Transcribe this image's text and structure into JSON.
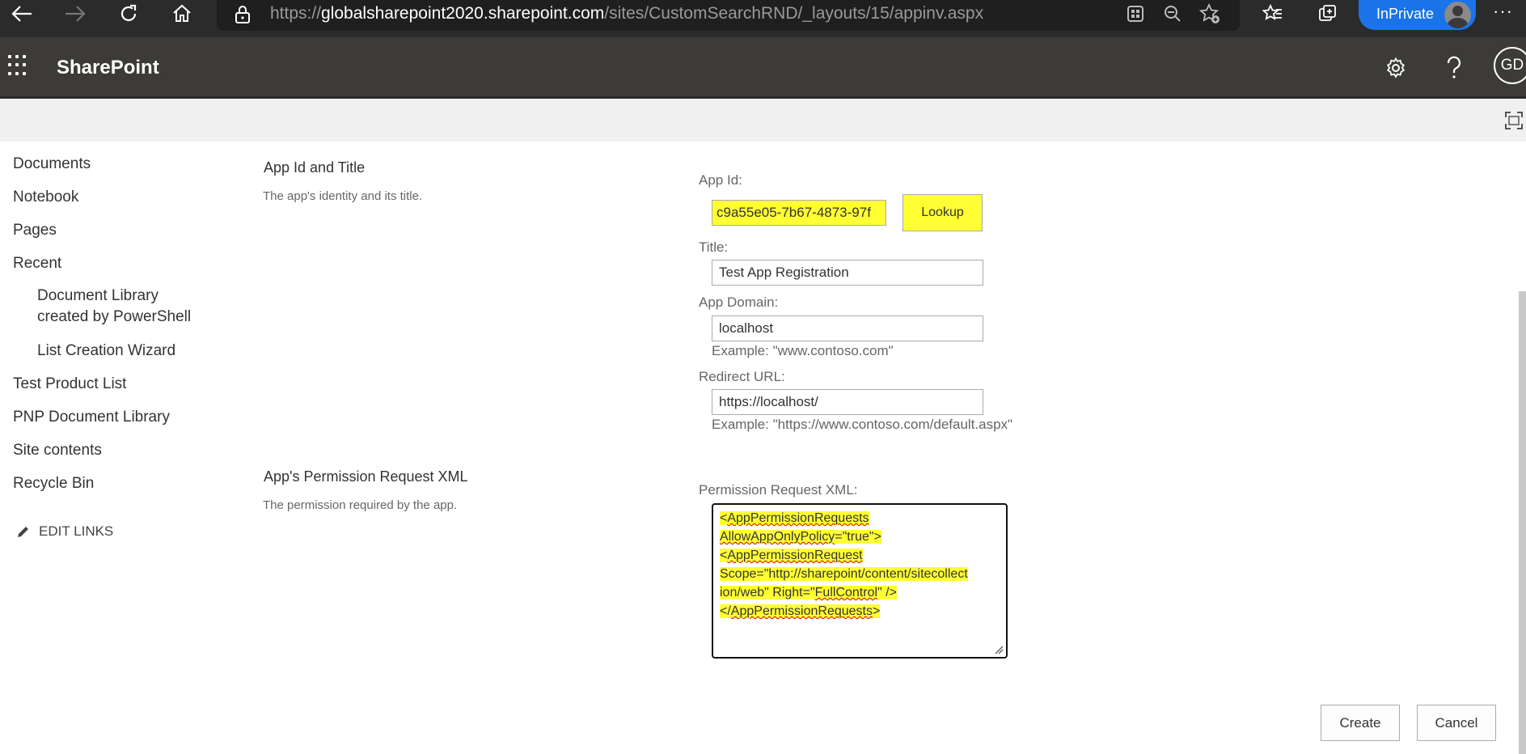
{
  "browser": {
    "url_prefix": "https://",
    "url_host": "globalsharepoint2020.sharepoint.com",
    "url_path": "/sites/CustomSearchRND/_layouts/15/appinv.aspx",
    "inprivate_label": "InPrivate",
    "more_label": "···"
  },
  "suite": {
    "brand": "SharePoint",
    "user_initials": "GD"
  },
  "nav": {
    "items": [
      {
        "label": "Documents"
      },
      {
        "label": "Notebook"
      },
      {
        "label": "Pages"
      },
      {
        "label": "Recent"
      },
      {
        "label": "Document Library created by PowerShell"
      },
      {
        "label": "List Creation Wizard"
      },
      {
        "label": "Test Product List"
      },
      {
        "label": "PNP Document Library"
      },
      {
        "label": "Site contents"
      },
      {
        "label": "Recycle Bin"
      }
    ],
    "edit_links": "EDIT LINKS"
  },
  "sections": {
    "app_id_title": {
      "heading": "App Id and Title",
      "description": "The app's identity and its title."
    },
    "permission_xml": {
      "heading": "App's Permission Request XML",
      "description": "The permission required by the app."
    }
  },
  "form": {
    "app_id_label": "App Id:",
    "app_id_value": "c9a55e05-7b67-4873-97f",
    "lookup_label": "Lookup",
    "title_label": "Title:",
    "title_value": "Test App Registration",
    "domain_label": "App Domain:",
    "domain_value": "localhost",
    "domain_example": "Example: \"www.contoso.com\"",
    "redirect_label": "Redirect URL:",
    "redirect_value": "https://localhost/",
    "redirect_example": "Example: \"https://www.contoso.com/default.aspx\"",
    "xml_label": "Permission Request XML:",
    "xml_lines": [
      [
        "<",
        "AppPermissionRequests",
        ""
      ],
      [
        "",
        "AllowAppOnlyPolicy",
        "=\"true\">"
      ],
      [
        "<",
        "AppPermissionRequest",
        ""
      ],
      [
        "Scope=\"http://sharepoint/content/sitecollect",
        "",
        ""
      ],
      [
        "ion/web\" Right=\"",
        "FullControl",
        "\" />"
      ],
      [
        "</",
        "AppPermissionRequests",
        ">"
      ]
    ],
    "create_label": "Create",
    "cancel_label": "Cancel"
  }
}
